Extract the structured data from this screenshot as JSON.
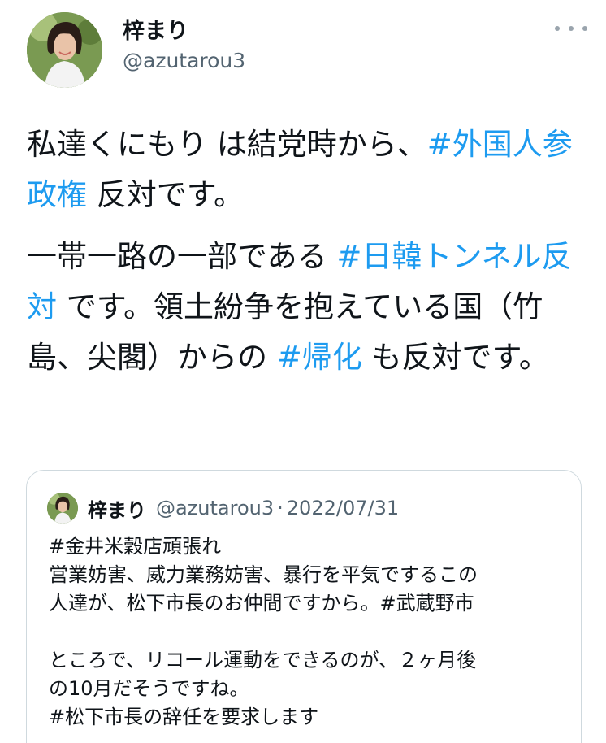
{
  "author": {
    "display_name": "梓まり",
    "handle": "@azutarou3",
    "avatar_icon": "profile-photo"
  },
  "more_icon": "more-horizontal-icon",
  "tweet": {
    "p1": {
      "t1": "私達くにもり は結党時から、",
      "tag1": "#外国人参政権",
      "t2": " 反対です。"
    },
    "p2": {
      "t1": "一帯一路の一部である ",
      "tag1": "#日韓トンネル反対",
      "t2": " です。領土紛争を抱えている国（竹島、尖閣）からの ",
      "tag2": "#帰化",
      "t3": " も反対です。"
    }
  },
  "quoted_tweet": {
    "display_name": "梓まり",
    "handle": "@azutarou3",
    "separator": "·",
    "date": "2022/07/31",
    "lines": {
      "l1_tag": "#金井米穀店頑張れ",
      "l2": "営業妨害、威力業務妨害、暴行を平気でするこの",
      "l3_text": "人達が、松下市長のお仲間ですから。",
      "l3_tag": "#武蔵野市",
      "l5": "ところで、リコール運動をできるのが、２ヶ月後",
      "l6": "の10月だそうですね。",
      "l7_tag": "#松下市長の辞任を要求します"
    }
  },
  "colors": {
    "text": "#0f1419",
    "secondary": "#536471",
    "link": "#1d9bf0",
    "border": "#cfd9de"
  }
}
